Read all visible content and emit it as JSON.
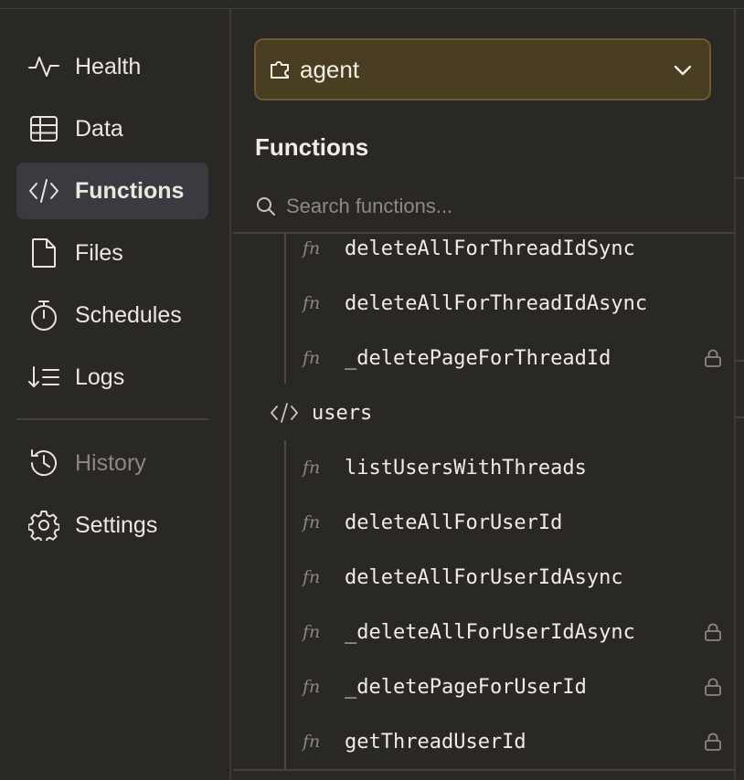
{
  "nav": {
    "items": [
      {
        "label": "Health",
        "icon": "activity-icon",
        "state": "normal"
      },
      {
        "label": "Data",
        "icon": "table-icon",
        "state": "normal"
      },
      {
        "label": "Functions",
        "icon": "code-icon",
        "state": "active"
      },
      {
        "label": "Files",
        "icon": "file-icon",
        "state": "normal"
      },
      {
        "label": "Schedules",
        "icon": "stopwatch-icon",
        "state": "normal"
      },
      {
        "label": "Logs",
        "icon": "logs-icon",
        "state": "normal"
      },
      {
        "label": "History",
        "icon": "history-icon",
        "state": "disabled"
      },
      {
        "label": "Settings",
        "icon": "gear-icon",
        "state": "normal"
      }
    ]
  },
  "selector": {
    "value": "agent",
    "icon": "component-icon"
  },
  "panel": {
    "title": "Functions"
  },
  "search": {
    "placeholder": "Search functions..."
  },
  "tree": {
    "fn_prefix": "fn",
    "group1": [
      {
        "name": "deleteAllForThreadIdSync",
        "locked": false
      },
      {
        "name": "deleteAllForThreadIdAsync",
        "locked": false
      },
      {
        "name": "_deletePageForThreadId",
        "locked": true
      }
    ],
    "module": {
      "name": "users"
    },
    "group2": [
      {
        "name": "listUsersWithThreads",
        "locked": false
      },
      {
        "name": "deleteAllForUserId",
        "locked": false
      },
      {
        "name": "deleteAllForUserIdAsync",
        "locked": false
      },
      {
        "name": "_deleteAllForUserIdAsync",
        "locked": true
      },
      {
        "name": "_deletePageForUserId",
        "locked": true
      },
      {
        "name": "getThreadUserId",
        "locked": true
      }
    ]
  },
  "colors": {
    "accent_selector": "#4a3e22",
    "active_nav": "#3b3a41",
    "background": "#2a2825"
  }
}
